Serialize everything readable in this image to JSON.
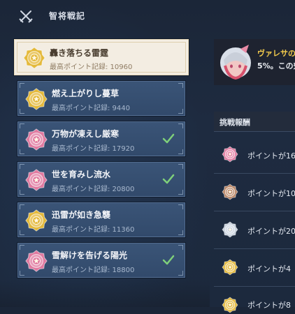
{
  "header": {
    "title": "智将戦記",
    "icon": "crossed-swords-icon"
  },
  "entries": [
    {
      "name": "轟き落ちる雷霆",
      "score": "最高ポイント記録: 10960",
      "medal": "gold",
      "completed": false,
      "selected": true
    },
    {
      "name": "燃え上がりし蔓草",
      "score": "最高ポイント記録: 9440",
      "medal": "gold",
      "completed": false,
      "selected": false
    },
    {
      "name": "万物が凍えし厳寒",
      "score": "最高ポイント記録: 17920",
      "medal": "pink",
      "completed": true,
      "selected": false
    },
    {
      "name": "世を育みし流水",
      "score": "最高ポイント記録: 20800",
      "medal": "pink",
      "completed": true,
      "selected": false
    },
    {
      "name": "迅雷が如き急襲",
      "score": "最高ポイント記録: 11360",
      "medal": "gold",
      "completed": false,
      "selected": false
    },
    {
      "name": "雪解けを告げる陽光",
      "score": "最高ポイント記録: 18800",
      "medal": "pink",
      "completed": true,
      "selected": false
    }
  ],
  "banner": {
    "line1": "ヴァレサの",
    "line2": "5%。この効"
  },
  "rewards": {
    "title": "挑戦報酬",
    "items": [
      {
        "text": "ポイントが16",
        "medal": "pink"
      },
      {
        "text": "ポイントが10",
        "medal": "bronze"
      },
      {
        "text": "ポイントが20",
        "medal": "silver"
      },
      {
        "text": "ポイントが4",
        "medal": "gold"
      },
      {
        "text": "ポイントが8",
        "medal": "gold"
      }
    ]
  },
  "colors": {
    "gold": "#e4b93b",
    "pink": "#e07aa0",
    "bronze": "#b98463",
    "silver": "#c9d2de",
    "check": "#7fd07a",
    "highlight_text": "#f3cb4c"
  }
}
